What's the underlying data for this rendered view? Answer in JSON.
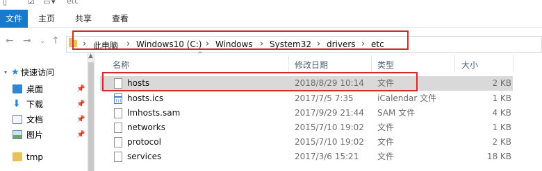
{
  "window": {
    "title": "etc"
  },
  "ribbon": {
    "tabs": [
      "文件",
      "主页",
      "共享",
      "查看"
    ]
  },
  "address": {
    "crumbs": [
      "此电脑",
      "Windows10 (C:)",
      "Windows",
      "System32",
      "drivers",
      "etc"
    ]
  },
  "nav_pane": {
    "quick_access": "快速访问",
    "items": [
      {
        "label": "桌面",
        "icon": "desktop-icon",
        "pinned": true
      },
      {
        "label": "下载",
        "icon": "download-arrow-icon",
        "pinned": true
      },
      {
        "label": "文档",
        "icon": "document-icon",
        "pinned": true
      },
      {
        "label": "图片",
        "icon": "picture-icon",
        "pinned": true
      },
      {
        "label": "tmp",
        "icon": "folder-icon",
        "pinned": false
      }
    ]
  },
  "columns": {
    "name": "名称",
    "date": "修改日期",
    "type": "类型",
    "size": "大小"
  },
  "files": [
    {
      "name": "hosts",
      "date": "2018/8/29 10:14",
      "type": "文件",
      "size": "2 KB",
      "selected": true,
      "icon": "file-icon"
    },
    {
      "name": "hosts.ics",
      "date": "2017/7/5 7:35",
      "type": "iCalendar 文件",
      "size": "1 KB",
      "selected": false,
      "icon": "calendar-file-icon"
    },
    {
      "name": "lmhosts.sam",
      "date": "2017/9/29 21:44",
      "type": "SAM 文件",
      "size": "4 KB",
      "selected": false,
      "icon": "file-icon"
    },
    {
      "name": "networks",
      "date": "2015/7/10 19:02",
      "type": "文件",
      "size": "1 KB",
      "selected": false,
      "icon": "file-icon"
    },
    {
      "name": "protocol",
      "date": "2015/7/10 19:02",
      "type": "文件",
      "size": "2 KB",
      "selected": false,
      "icon": "file-icon"
    },
    {
      "name": "services",
      "date": "2017/3/6 15:21",
      "type": "文件",
      "size": "18 KB",
      "selected": false,
      "icon": "file-icon"
    }
  ],
  "colors": {
    "accent": "#1979ca",
    "highlight": "#d9272e",
    "selection": "#d9d9d9"
  }
}
